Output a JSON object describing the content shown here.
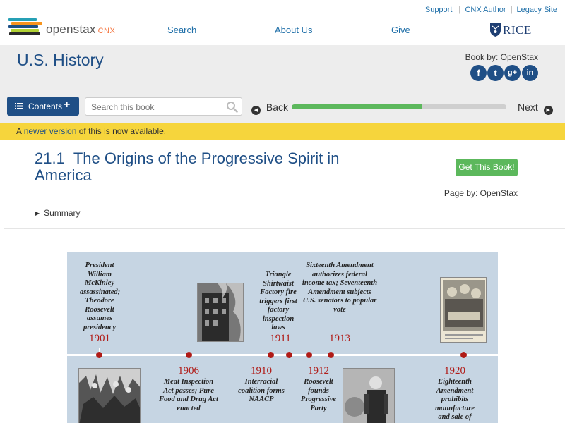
{
  "header": {
    "logo_text": "openstax",
    "logo_suffix": "CNX",
    "toplinks": [
      "Support",
      "CNX Author",
      "Legacy Site"
    ],
    "nav": [
      "Search",
      "About Us",
      "Give"
    ],
    "partner_logo": "RICE",
    "logo_colors": [
      "#26a0b5",
      "#f7941d",
      "#1b4f86",
      "#b2d235",
      "#e5e5e5"
    ]
  },
  "book": {
    "title": "U.S. History",
    "by_label": "Book by: OpenStax",
    "social_icons": [
      "facebook-icon",
      "twitter-icon",
      "google-plus-icon",
      "linkedin-icon"
    ],
    "social_glyphs": [
      "f",
      "t",
      "g+",
      "in"
    ]
  },
  "toolbar": {
    "contents_label": "Contents",
    "search_placeholder": "Search this book",
    "back_label": "Back",
    "next_label": "Next",
    "progress_percent": 61
  },
  "notice": {
    "prefix": "A",
    "link": "newer version",
    "suffix": "of this is now available."
  },
  "page": {
    "section_number": "21.1",
    "section_title": "The Origins of the Progressive Spirit in America",
    "get_book_label": "Get This Book!",
    "page_by_label": "Page by: OpenStax",
    "summary_label": "Summary"
  },
  "timeline": {
    "colors": {
      "background": "#c6d5e3",
      "accent": "#b01b17",
      "line": "#ffffff"
    },
    "events_top": [
      {
        "year": "1901",
        "caption": "President William McKinley assassinated; Theodore Roosevelt assumes presidency"
      },
      {
        "year": "1911",
        "caption": "Triangle Shirtwaist Factory fire triggers first factory inspection laws"
      },
      {
        "year": "1913",
        "caption": "Sixteenth Amendment authorizes federal income tax; Seventeenth Amendment subjects U.S. senators to popular vote"
      }
    ],
    "events_bottom": [
      {
        "year": "1906",
        "caption": "Meat Inspection Act passes; Pure Food and Drug Act enacted"
      },
      {
        "year": "1910",
        "caption": "Interracial coalition forms NAACP"
      },
      {
        "year": "1912",
        "caption": "Roosevelt founds Progressive Party"
      },
      {
        "year": "1920",
        "caption": "Eighteenth Amendment prohibits manufacture and sale of"
      }
    ]
  }
}
